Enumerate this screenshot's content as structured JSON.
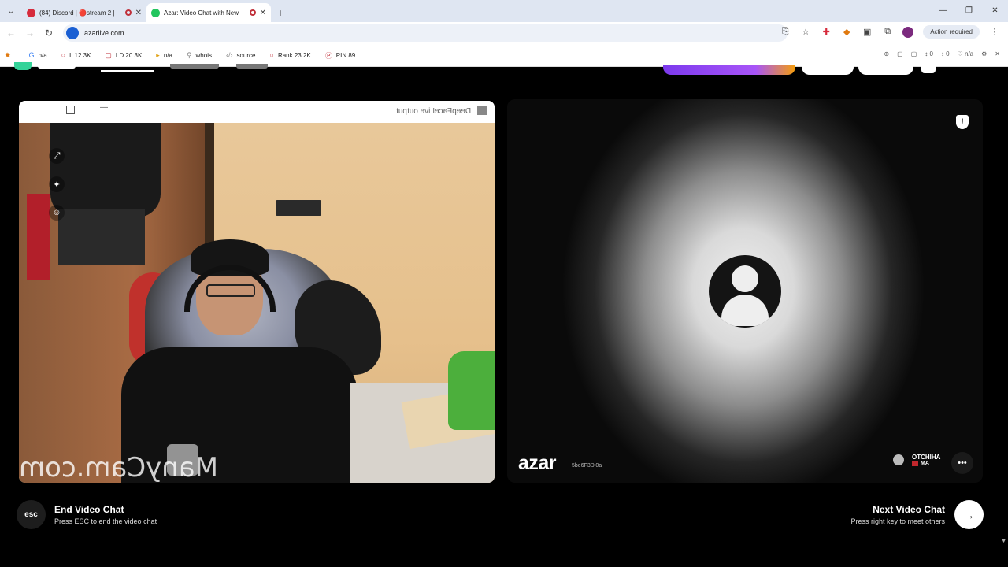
{
  "browser": {
    "tabs": [
      {
        "title": "(84) Discord | 🔴stream 2 |",
        "active": false,
        "favicon_color": "#d62b3c"
      },
      {
        "title": "Azar: Video Chat with New",
        "active": true,
        "favicon_color": "#22c55e"
      }
    ],
    "new_tab_icon": "+",
    "window_controls": [
      "—",
      "❐",
      "✕"
    ],
    "url": "azarlive.com",
    "action_required": "Action required",
    "extensions": [
      {
        "icon": "G",
        "label": "n/a"
      },
      {
        "icon": "○",
        "label": "L 12.3K"
      },
      {
        "icon": "▢",
        "label": "LD 20.3K"
      },
      {
        "icon": "▸",
        "label": "n/a"
      },
      {
        "icon": "⚲",
        "label": "whois"
      },
      {
        "icon": "‹/›",
        "label": "source"
      },
      {
        "icon": "○",
        "label": "Rank 23.2K"
      },
      {
        "icon": "Ⓟ",
        "label": "PIN 89"
      }
    ],
    "ext_right": [
      "⊕",
      "▢",
      "▢",
      "↕ 0",
      "↕ 0",
      "♡ n/a",
      "⚙",
      "✕"
    ]
  },
  "local_video": {
    "window_title": "DeepFaceLive output",
    "watermark": "ManyCam.com"
  },
  "remote_video": {
    "brand": "azar",
    "room_code": "5be6F3Di0a",
    "partner_name": "OTCHIHA",
    "partner_country": "MA",
    "shield_icon": "!",
    "chat_icon": "•••"
  },
  "controls": {
    "end_key": "esc",
    "end_title": "End Video Chat",
    "end_sub": "Press ESC to end the video chat",
    "next_title": "Next Video Chat",
    "next_sub": "Press right key to meet others",
    "next_icon": "→"
  }
}
